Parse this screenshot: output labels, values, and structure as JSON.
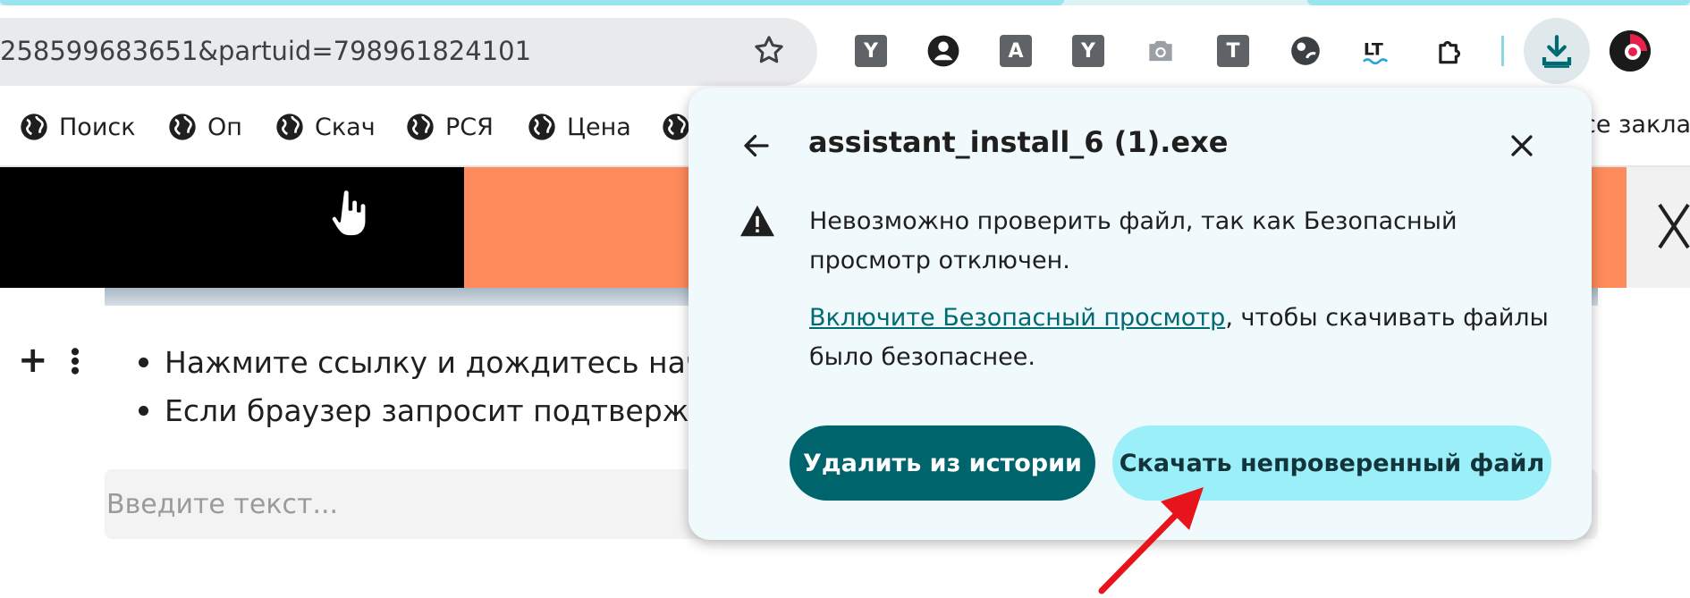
{
  "toolbar": {
    "url": "258599683651&partuid=798961824101",
    "extensions": [
      "Y",
      "A",
      "Y",
      "T"
    ]
  },
  "bookmarks": {
    "items": [
      {
        "label": "Поиск"
      },
      {
        "label": "Оп"
      },
      {
        "label": "Скач"
      },
      {
        "label": "РСЯ"
      },
      {
        "label": "Цена"
      }
    ],
    "all_label": "се заклад"
  },
  "content": {
    "bullets": [
      "Нажмите ссылку и дождитесь начало",
      "Если браузер запросит подтвержден"
    ],
    "input_placeholder": "Введите текст..."
  },
  "popup": {
    "title": "assistant_install_6 (1).exe",
    "warning": "Невозможно проверить файл, так как Безопасный просмотр отключен.",
    "link_text": "Включите Безопасный просмотр",
    "link_suffix": ", чтобы скачивать файлы было безопаснее.",
    "delete_label": "Удалить из истории",
    "download_label": "Скачать непроверенный файл"
  },
  "colors": {
    "primary_button": "#00646d",
    "secondary_button": "#9beff8",
    "banner_orange": "#ff8a5c",
    "annotation_arrow": "#e8141c"
  }
}
